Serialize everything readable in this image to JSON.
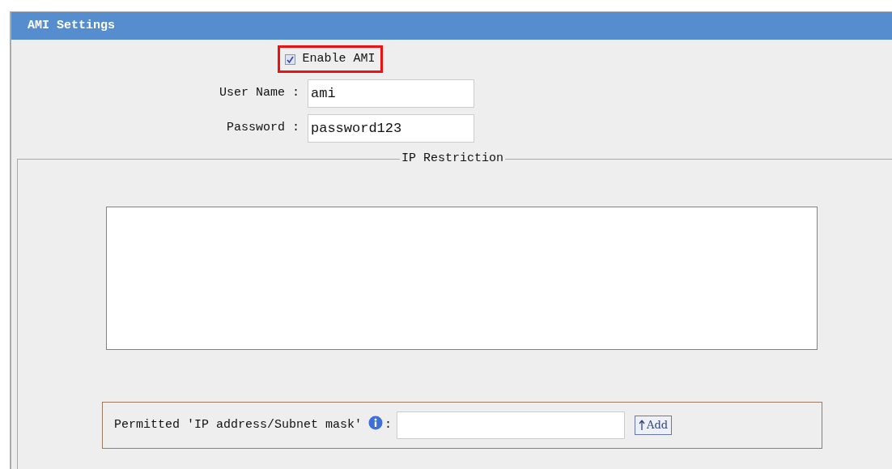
{
  "panel": {
    "title": "AMI Settings"
  },
  "enable": {
    "label": "Enable AMI",
    "checked": true,
    "highlighted": true
  },
  "fields": [
    {
      "label": "User Name :",
      "value": "ami"
    },
    {
      "label": "Password :",
      "value": "password123"
    }
  ],
  "ip_restriction": {
    "legend": "IP Restriction",
    "permitted_label": "Permitted 'IP address/Subnet mask'",
    "colon": ":",
    "add_button": "Add"
  }
}
